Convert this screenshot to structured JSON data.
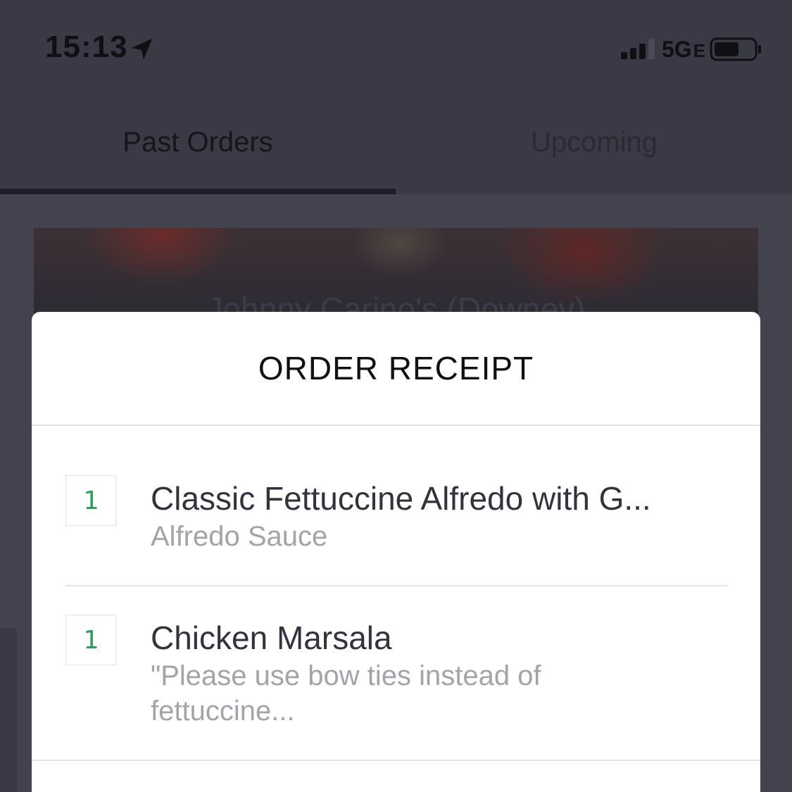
{
  "status_bar": {
    "time": "15:13",
    "network": "5G",
    "network_suffix": "E",
    "icons": [
      "location-arrow-icon",
      "signal-icon",
      "battery-icon"
    ]
  },
  "tabs": [
    {
      "label": "Past Orders",
      "selected": true
    },
    {
      "label": "Upcoming",
      "selected": false
    }
  ],
  "restaurant": {
    "name": "Johnny Carino's (Downey)"
  },
  "receipt": {
    "title": "ORDER RECEIPT",
    "items": [
      {
        "quantity": "1",
        "name": "Classic Fettuccine Alfredo with G...",
        "note": "Alfredo Sauce"
      },
      {
        "quantity": "1",
        "name": "Chicken Marsala",
        "note": "\"Please use bow ties instead of fettuccine..."
      }
    ]
  },
  "colors": {
    "accent": "#2d9f59",
    "overlay": "#3a3946",
    "tab_indicator": "#1d1b2c"
  }
}
